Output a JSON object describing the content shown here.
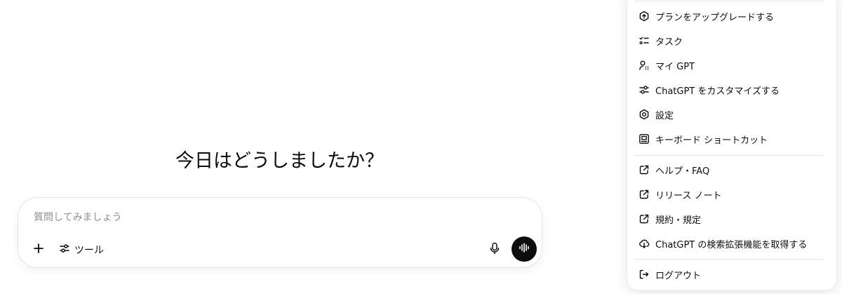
{
  "main": {
    "greeting": "今日はどうしましたか？"
  },
  "composer": {
    "placeholder": "質問してみましょう",
    "tools_label": "ツール",
    "icons": [
      "plus-icon",
      "tools-sliders-icon",
      "microphone-icon",
      "voice-mode-icon"
    ]
  },
  "menu": {
    "items": [
      {
        "label": "プランをアップグレードする",
        "icon": "upgrade-icon"
      },
      {
        "label": "タスク",
        "icon": "tasks-icon"
      },
      {
        "label": "マイ GPT",
        "icon": "my-gpt-icon"
      },
      {
        "label": "ChatGPT をカスタマイズする",
        "icon": "customize-icon"
      },
      {
        "label": "設定",
        "icon": "settings-gear-icon"
      },
      {
        "label": "キーボード ショートカット",
        "icon": "keyboard-icon"
      },
      {
        "label": "ヘルプ・FAQ",
        "icon": "external-link-icon"
      },
      {
        "label": "リリース ノート",
        "icon": "external-link-icon"
      },
      {
        "label": "規約・規定",
        "icon": "external-link-icon"
      },
      {
        "label": "ChatGPT の検索拡張機能を取得する",
        "icon": "download-cloud-icon"
      },
      {
        "label": "ログアウト",
        "icon": "logout-icon"
      }
    ]
  }
}
